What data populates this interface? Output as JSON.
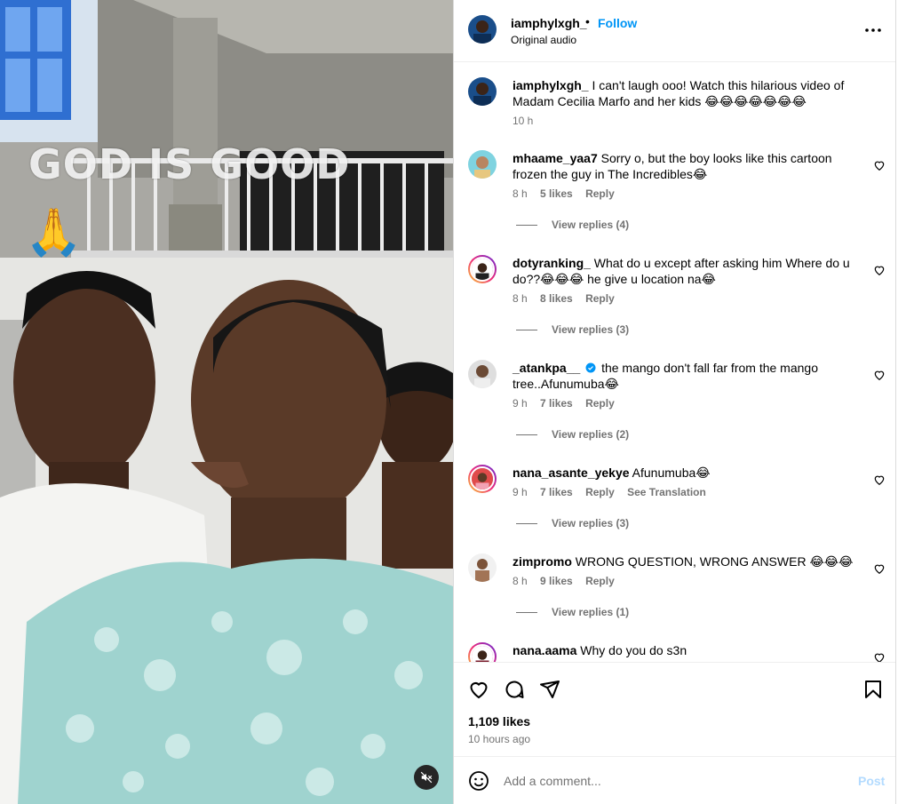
{
  "media": {
    "overlay_text": "GOD IS GOOD",
    "overlay_emoji": "🙏",
    "mute_icon": "speaker-muted-icon"
  },
  "header": {
    "username": "iamphylxgh_",
    "separator": "•",
    "follow_label": "Follow",
    "audio_label": "Original audio",
    "more_icon": "more-horizontal-icon"
  },
  "caption": {
    "username": "iamphylxgh_",
    "text": "I can't laugh ooo! Watch this hilarious video of Madam Cecilia Marfo and her kids 😂😂😂😂😂😂😂",
    "time": "10 h"
  },
  "comments": [
    {
      "username": "mhaame_yaa7",
      "verified": false,
      "text": "Sorry o, but the boy looks like this cartoon frozen the guy in The Incredibles😂",
      "time": "8 h",
      "likes": "5 likes",
      "reply_label": "Reply",
      "view_replies": "View replies (4)"
    },
    {
      "username": "dotyranking_",
      "verified": false,
      "text": "What do u except after asking him Where do u do??😂😂😂 he give u location na😂",
      "time": "8 h",
      "likes": "8 likes",
      "reply_label": "Reply",
      "view_replies": "View replies (3)"
    },
    {
      "username": "_atankpa__",
      "verified": true,
      "text": "the mango don't fall far from the mango tree..Afunumuba😂",
      "time": "9 h",
      "likes": "7 likes",
      "reply_label": "Reply",
      "view_replies": "View replies (2)"
    },
    {
      "username": "nana_asante_yekye",
      "verified": false,
      "text": "Afunumuba😂",
      "time": "9 h",
      "likes": "7 likes",
      "reply_label": "Reply",
      "translation_label": "See Translation",
      "view_replies": "View replies (3)"
    },
    {
      "username": "zimpromo",
      "verified": false,
      "text": "WRONG QUESTION, WRONG ANSWER 😂😂😂",
      "time": "8 h",
      "likes": "9 likes",
      "reply_label": "Reply",
      "view_replies": "View replies (1)"
    },
    {
      "username": "nana.aama",
      "verified": false,
      "text": "Why do you do s3n"
    }
  ],
  "actions": {
    "like_icon": "heart-icon",
    "comment_icon": "comment-icon",
    "share_icon": "share-icon",
    "save_icon": "bookmark-icon",
    "likes_count": "1,109 likes",
    "posted_ago": "10 hours ago"
  },
  "add_comment": {
    "emoji_icon": "smiley-icon",
    "placeholder": "Add a comment...",
    "post_label": "Post"
  },
  "colors": {
    "accent": "#0095f6",
    "post_disabled": "#b3dbff",
    "muted_text": "#737373",
    "verified": "#0095f6"
  }
}
